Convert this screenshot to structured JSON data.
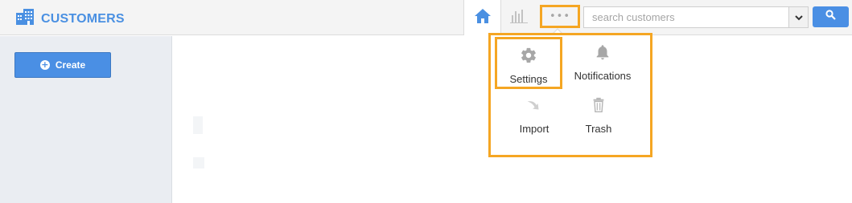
{
  "header": {
    "app_title": "CUSTOMERS",
    "app_icon": "building-icon",
    "home_icon": "home-icon",
    "chart_icon": "bar-chart-icon",
    "more_icon": "more-dots-icon",
    "more_glyph": "•••"
  },
  "search": {
    "placeholder": "search customers",
    "value": "",
    "dropdown_icon": "chevron-down-icon",
    "submit_icon": "search-icon"
  },
  "sidebar": {
    "create_label": "Create",
    "create_icon": "plus-circle-icon"
  },
  "more_menu": {
    "items": [
      {
        "label": "Settings",
        "icon": "gear-icon"
      },
      {
        "label": "Notifications",
        "icon": "bell-icon"
      },
      {
        "label": "Import",
        "icon": "import-arrow-icon"
      },
      {
        "label": "Trash",
        "icon": "trash-icon"
      }
    ]
  },
  "colors": {
    "accent": "#4a90e2",
    "highlight": "#f5a623",
    "icon_grey": "#a7a7a7",
    "sidebar_bg": "#eaedf2"
  }
}
